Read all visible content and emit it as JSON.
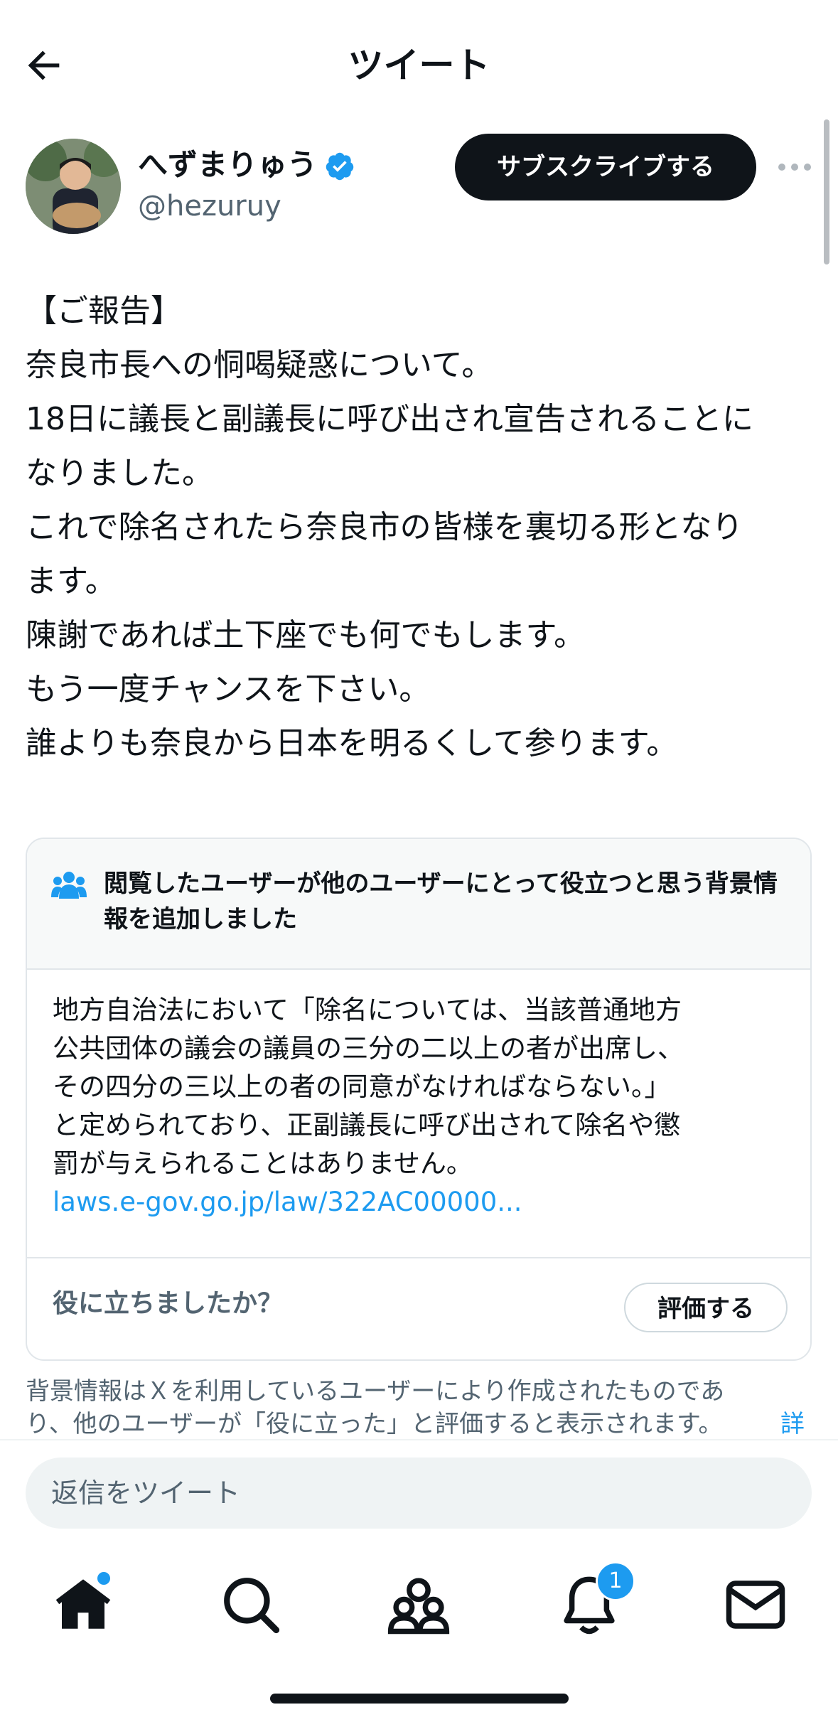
{
  "header": {
    "title": "ツイート",
    "back_icon": "arrow-left-icon"
  },
  "author": {
    "name": "へずまりゅう",
    "handle": "@hezuruy",
    "verified": true,
    "subscribe_label": "サブスクライブする",
    "more_icon": "more-horizontal-icon"
  },
  "tweet": {
    "lines": [
      "【ご報告】",
      "奈良市長への恫喝疑惑について。",
      "18日に議長と副議長に呼び出され宣告されることに",
      "なりました。",
      "これで除名されたら奈良市の皆様を裏切る形となり",
      "ます。",
      "陳謝であれば土下座でも何でもします。",
      "もう一度チャンスを下さい。",
      "誰よりも奈良から日本を明るくして参ります。"
    ]
  },
  "note": {
    "title": "閲覧したユーザーが他のユーザーにとって役立つと思う背景情報を追加しました",
    "body_lines": [
      "地方自治法において「除名については、当該普通地方",
      "公共団体の議会の議員の三分の二以上の者が出席し、",
      "その四分の三以上の者の同意がなければならない。」",
      "と定められており、正副議長に呼び出されて除名や懲",
      "罰が与えられることはありません。"
    ],
    "link": "laws.e-gov.go.jp/law/322AC00000...",
    "helpful_question": "役に立ちましたか？",
    "rate_label": "評価する"
  },
  "disclaimer": {
    "lines": [
      "背景情報はＸを利用しているユーザーにより作成されたものであ",
      "り、他のユーザーが「役に立った」と評価すると表示されます。"
    ],
    "more": "詳"
  },
  "reply": {
    "placeholder": "返信をツイート"
  },
  "nav": {
    "items": [
      "home-icon",
      "search-icon",
      "communities-icon",
      "notifications-icon",
      "messages-icon"
    ],
    "notification_count": "1"
  },
  "colors": {
    "accent": "#1d9bf0",
    "text": "#0f1419",
    "secondary": "#536471"
  }
}
